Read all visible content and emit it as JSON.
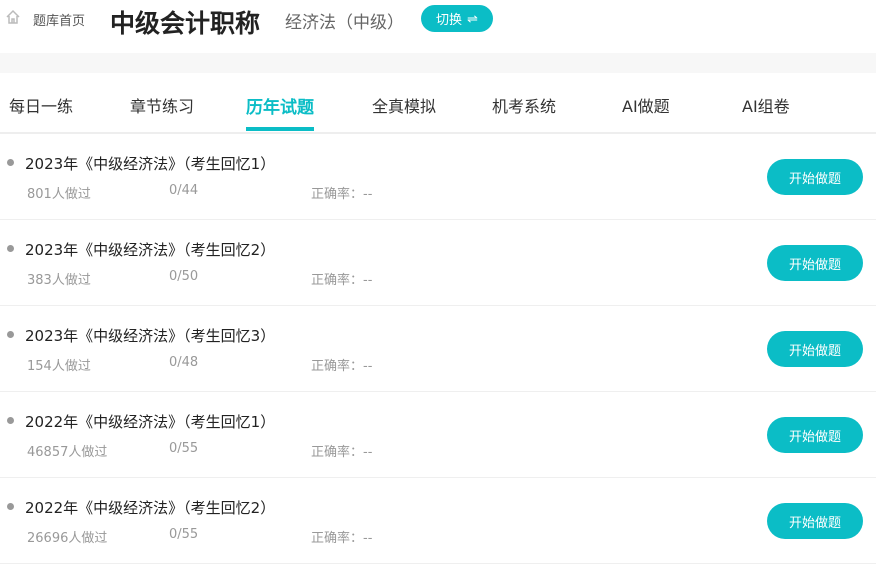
{
  "header": {
    "home_label": "题库首页",
    "title": "中级会计职称",
    "subject": "经济法（中级）",
    "switch_label": "切换",
    "switch_icon": "⇌"
  },
  "tabs": [
    {
      "label": "每日一练"
    },
    {
      "label": "章节练习"
    },
    {
      "label": "历年试题",
      "active": true
    },
    {
      "label": "全真模拟"
    },
    {
      "label": "机考系统"
    },
    {
      "label": "AI做题"
    },
    {
      "label": "AI组卷"
    }
  ],
  "papers": [
    {
      "title": "2023年《中级经济法》（考生回忆1）",
      "done": "801人做过",
      "progress": "0/44",
      "accuracy": "正确率：--",
      "button": "开始做题"
    },
    {
      "title": "2023年《中级经济法》（考生回忆2）",
      "done": "383人做过",
      "progress": "0/50",
      "accuracy": "正确率：--",
      "button": "开始做题"
    },
    {
      "title": "2023年《中级经济法》（考生回忆3）",
      "done": "154人做过",
      "progress": "0/48",
      "accuracy": "正确率：--",
      "button": "开始做题"
    },
    {
      "title": "2022年《中级经济法》（考生回忆1）",
      "done": "46857人做过",
      "progress": "0/55",
      "accuracy": "正确率：--",
      "button": "开始做题"
    },
    {
      "title": "2022年《中级经济法》（考生回忆2）",
      "done": "26696人做过",
      "progress": "0/55",
      "accuracy": "正确率：--",
      "button": "开始做题"
    }
  ]
}
